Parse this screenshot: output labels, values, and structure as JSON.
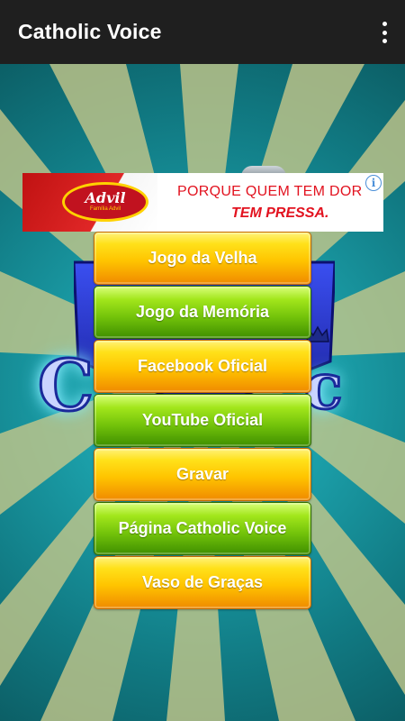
{
  "app_bar": {
    "title": "Catholic Voice",
    "overflow_icon": "more-vertical-icon"
  },
  "logo": {
    "left_letter": "C",
    "right_letter": "c"
  },
  "ad": {
    "brand": "Advil",
    "brand_sub": "Família Advil",
    "line1": "PORQUE QUEM TEM DOR",
    "line2": "TEM PRESSA.",
    "info_icon": "info-icon",
    "info_glyph": "i"
  },
  "menu": {
    "items": [
      {
        "label": "Jogo da Velha",
        "style": "yellow"
      },
      {
        "label": "Jogo da Memória",
        "style": "green"
      },
      {
        "label": "Facebook Oficial",
        "style": "yellow"
      },
      {
        "label": "YouTube Oficial",
        "style": "green"
      },
      {
        "label": "Gravar",
        "style": "yellow"
      },
      {
        "label": "Página Catholic Voice",
        "style": "green"
      },
      {
        "label": "Vaso de Graças",
        "style": "yellow"
      }
    ]
  },
  "colors": {
    "app_bar": "#1f1f1f",
    "background_teal": "#1b9ea8",
    "sunburst_ray": "#c9c98a",
    "button_yellow": "#ffc400",
    "button_green": "#72c20a",
    "ad_red": "#e2121f"
  }
}
